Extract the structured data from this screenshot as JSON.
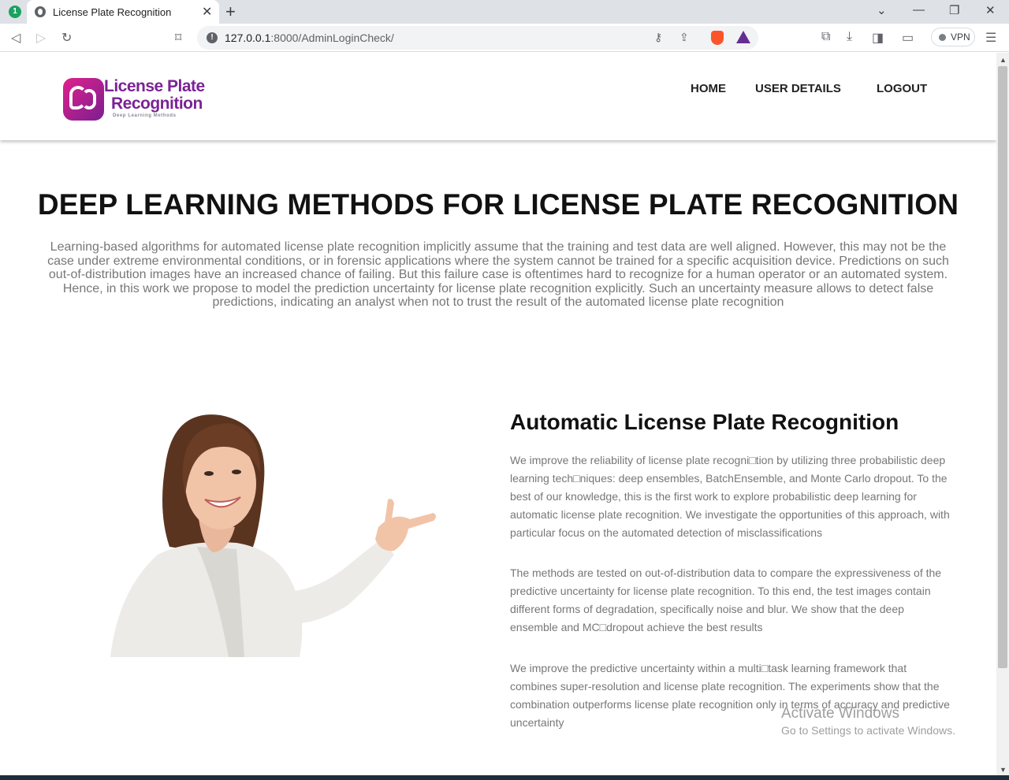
{
  "browser": {
    "tab_badge": "1",
    "tab_title": "License Plate Recognition",
    "url_host": "127.0.0.1",
    "url_rest": ":8000/AdminLoginCheck/",
    "vpn_label": "VPN"
  },
  "header": {
    "logo_line1": "License Plate",
    "logo_line2": "Recognition",
    "logo_tagline": "Deep Learning Methods",
    "logo_colors": [
      "#e0208e",
      "#7b1f8f"
    ],
    "nav": [
      {
        "label": "HOME"
      },
      {
        "label": "USER DETAILS"
      },
      {
        "label": "LOGOUT"
      }
    ]
  },
  "hero": {
    "title": "DEEP LEARNING METHODS FOR LICENSE PLATE RECOGNITION",
    "text": "Learning-based algorithms for automated license plate recognition implicitly assume that the training and test data are well aligned. However, this may not be the case under extreme environmental conditions, or in forensic applications where the system cannot be trained for a specific acquisition device. Predictions on such out-of-distribution images have an increased chance of failing. But this failure case is oftentimes hard to recognize for a human operator or an automated system. Hence, in this work we propose to model the prediction uncertainty for license plate recognition explicitly. Such an uncertainty measure allows to detect false predictions, indicating an analyst when not to trust the result of the automated license plate recognition"
  },
  "article": {
    "title": "Automatic License Plate Recognition",
    "paragraphs": [
      "We improve the reliability of license plate recogni□tion by utilizing three probabilistic deep learning tech□niques: deep ensembles, BatchEnsemble, and Monte Carlo dropout. To the best of our knowledge, this is the first work to explore probabilistic deep learning for automatic license plate recognition. We investigate the opportunities of this approach, with particular focus on the automated detection of misclassifications",
      "The methods are tested on out-of-distribution data to compare the expressiveness of the predictive uncertainty for license plate recognition. To this end, the test images contain different forms of degradation, specifically noise and blur. We show that the deep ensemble and MC□dropout achieve the best results",
      "We improve the predictive uncertainty within a multi□task learning framework that combines super-resolution and license plate recognition. The experiments show that the combination outperforms license plate recognition only in terms of accuracy and predictive uncertainty"
    ]
  },
  "watermark": {
    "line1": "Activate Windows",
    "line2": "Go to Settings to activate Windows."
  }
}
